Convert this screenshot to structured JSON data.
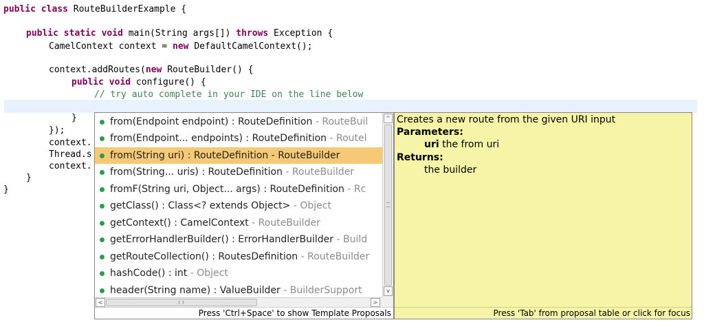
{
  "editor": {
    "lines": [
      {
        "kw": "public class",
        "text": " RouteBuilderExample {"
      },
      {
        "kw": "public static void",
        "text": " main(String args[]) ",
        "kw2": "throws",
        "text2": " Exception {"
      },
      {
        "text": "CamelContext context = ",
        "kw": "new",
        "text2": " DefaultCamelContext();"
      },
      {
        "text": "context.addRoutes(",
        "kw": "new",
        "text2": " RouteBuilder() {"
      },
      {
        "kw": "public void",
        "text": " configure() {"
      },
      {
        "comment": "// try auto complete in your IDE on the line below"
      },
      {
        "text": "}"
      },
      {
        "text": "});"
      },
      {
        "text": "context."
      },
      {
        "text": "Thread.s"
      },
      {
        "text": "context."
      },
      {
        "text": "}"
      },
      {
        "text": "}"
      }
    ]
  },
  "autocomplete": {
    "items": [
      {
        "signature": "from(Endpoint endpoint) : RouteDefinition",
        "owner": " - RouteBuil"
      },
      {
        "signature": "from(Endpoint... endpoints) : RouteDefinition",
        "owner": " - Routel"
      },
      {
        "signature": "from(String uri) : RouteDefinition - RouteBuilder",
        "owner": ""
      },
      {
        "signature": "from(String... uris) : RouteDefinition",
        "owner": " - RouteBuilder"
      },
      {
        "signature": "fromF(String uri, Object... args) : RouteDefinition",
        "owner": " - Rc"
      },
      {
        "signature": "getClass() : Class<? extends Object>",
        "owner": " - Object"
      },
      {
        "signature": "getContext() : CamelContext",
        "owner": " - RouteBuilder"
      },
      {
        "signature": "getErrorHandlerBuilder() : ErrorHandlerBuilder",
        "owner": " - Build"
      },
      {
        "signature": "getRouteCollection() : RoutesDefinition",
        "owner": " - RouteBuilder"
      },
      {
        "signature": "hashCode() : int",
        "owner": " - Object"
      },
      {
        "signature": "header(String name) : ValueBuilder",
        "owner": " - BuilderSupport"
      }
    ],
    "selected_index": 2,
    "scroll": {
      "up": "^",
      "down": "v",
      "left": "<",
      "right": ">"
    },
    "status": "Press 'Ctrl+Space' to show Template Proposals"
  },
  "doc": {
    "description": "Creates a new route from the given URI input",
    "params_label": "Parameters:",
    "param_name": "uri",
    "param_desc": " the from uri",
    "returns_label": "Returns:",
    "returns_desc": "the builder",
    "status": "Press 'Tab' from proposal table or click for focus"
  },
  "colors": {
    "keyword": "#7f0055",
    "comment": "#3f7f5f",
    "selection": "#f5c976",
    "doc_background": "#f6f4a7",
    "method_dot": "#2f9a4f"
  }
}
